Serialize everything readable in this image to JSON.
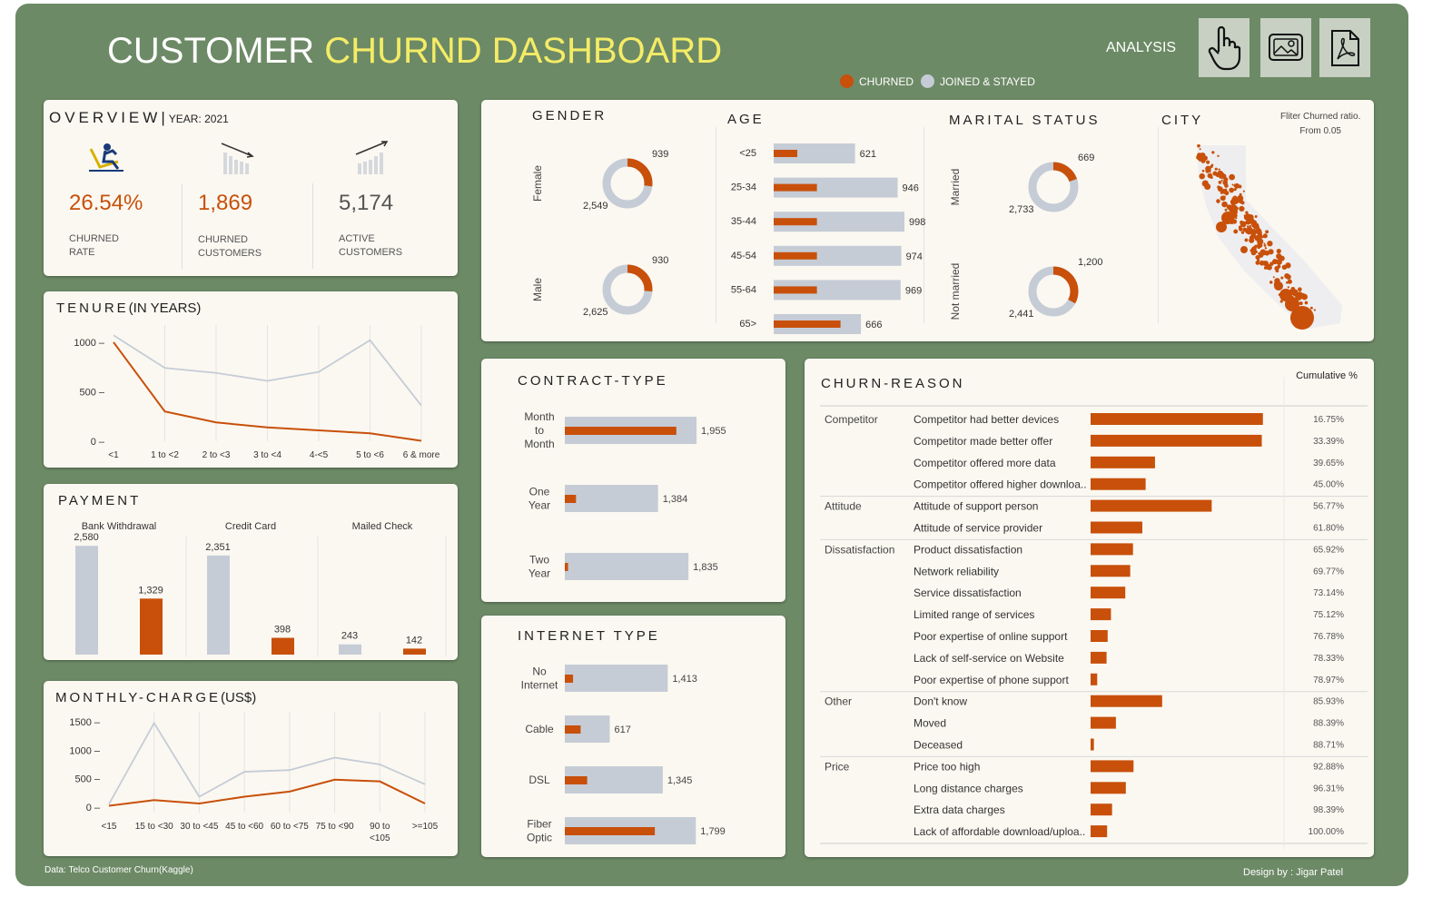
{
  "header": {
    "title_white": "CUSTOMER",
    "title_yellow": "CHURND DASHBOARD",
    "analysis_label": "ANALYSIS",
    "legend": [
      {
        "label": "CHURNED",
        "color": "#c8500a"
      },
      {
        "label": "JOINED & STAYED",
        "color": "#c5ccd6"
      }
    ],
    "icons": [
      "hand-pointer-icon",
      "image-icon",
      "pdf-icon"
    ]
  },
  "colors": {
    "churned": "#c8500a",
    "stayed": "#c5ccd6",
    "background": "#6d8a66",
    "card": "#fbf8f1",
    "title_yellow": "#f4ec66"
  },
  "overview": {
    "title": "OVERVIEW",
    "year_label": "YEAR: 2021",
    "kpis": [
      {
        "value": "26.54%",
        "label_1": "CHURNED",
        "label_2": "RATE",
        "icon": "person-falling-icon"
      },
      {
        "value": "1,869",
        "label_1": "CHURNED",
        "label_2": "CUSTOMERS",
        "icon": "bars-down-icon"
      },
      {
        "value": "5,174",
        "label_1": "ACTIVE",
        "label_2": "CUSTOMERS",
        "icon": "bars-up-icon"
      }
    ]
  },
  "tenure": {
    "title": "TENURE",
    "title_suffix": "(IN YEARS)"
  },
  "payment": {
    "title": "PAYMENT"
  },
  "monthly": {
    "title": "MONTHLY-CHARGE",
    "title_suffix": "(US$)"
  },
  "gender": {
    "title": "GENDER"
  },
  "age": {
    "title": "AGE"
  },
  "marital": {
    "title": "MARITAL STATUS"
  },
  "city": {
    "title": "CITY",
    "note_1": "Fliter Churned ratio.",
    "note_2": "From 0.05"
  },
  "contract": {
    "title": "CONTRACT-TYPE"
  },
  "internet": {
    "title": "INTERNET TYPE"
  },
  "reason": {
    "title": "CHURN-REASON",
    "cumulative_header": "Cumulative %"
  },
  "footer": {
    "source": "Data: Telco Customer Churn(Kaggle)",
    "credit": "Design by : Jigar Patel"
  },
  "chart_data": [
    {
      "id": "tenure",
      "type": "line",
      "categories": [
        "<1",
        "1 to <2",
        "2 to <3",
        "3 to <4",
        "4-<5",
        "5 to <6",
        "6 & more"
      ],
      "ylim": [
        0,
        1100
      ],
      "yticks": [
        0,
        500,
        1000
      ],
      "series": [
        {
          "name": "CHURNED",
          "values": [
            1000,
            300,
            190,
            140,
            110,
            80,
            5
          ]
        },
        {
          "name": "JOINED & STAYED",
          "values": [
            1070,
            740,
            690,
            610,
            700,
            1020,
            360
          ]
        }
      ]
    },
    {
      "id": "payment",
      "type": "bar",
      "groups": [
        {
          "label": "Bank Withdrawal",
          "stayed": 2580,
          "churned": 1329,
          "stayed_label": "2,580",
          "churned_label": "1,329"
        },
        {
          "label": "Credit Card",
          "stayed": 2351,
          "churned": 398,
          "stayed_label": "2,351",
          "churned_label": "398"
        },
        {
          "label": "Mailed Check",
          "stayed": 243,
          "churned": 142,
          "stayed_label": "243",
          "churned_label": "142"
        }
      ],
      "ylim": [
        0,
        2800
      ]
    },
    {
      "id": "monthly",
      "type": "line",
      "categories": [
        "<15",
        "15 to <30",
        "30 to <45",
        "45 to <60",
        "60 to <75",
        "75 to <90",
        "90 to <105",
        ">=105"
      ],
      "ylim": [
        -100,
        1550
      ],
      "yticks": [
        0,
        500,
        1000,
        1500
      ],
      "series": [
        {
          "name": "CHURNED",
          "values": [
            20,
            120,
            60,
            180,
            270,
            480,
            450,
            60
          ]
        },
        {
          "name": "JOINED & STAYED",
          "values": [
            50,
            1480,
            180,
            620,
            650,
            870,
            750,
            400
          ]
        }
      ]
    },
    {
      "id": "gender",
      "type": "pie",
      "items": [
        {
          "label": "Female",
          "churned": 939,
          "stayed": 2549,
          "churned_label": "939",
          "stayed_label": "2,549"
        },
        {
          "label": "Male",
          "churned": 930,
          "stayed": 2625,
          "churned_label": "930",
          "stayed_label": "2,625"
        }
      ]
    },
    {
      "id": "marital",
      "type": "pie",
      "items": [
        {
          "label": "Married",
          "churned": 669,
          "stayed": 2733,
          "churned_label": "669",
          "stayed_label": "2,733"
        },
        {
          "label": "Not married",
          "churned": 1200,
          "stayed": 2441,
          "churned_label": "1,200",
          "stayed_label": "2,441"
        }
      ]
    },
    {
      "id": "age",
      "type": "bar",
      "items": [
        {
          "label": "<25",
          "total": 621,
          "churned": 180,
          "total_label": "621"
        },
        {
          "label": "25-34",
          "total": 946,
          "churned": 330,
          "total_label": "946"
        },
        {
          "label": "35-44",
          "total": 998,
          "churned": 330,
          "total_label": "998"
        },
        {
          "label": "45-54",
          "total": 974,
          "churned": 330,
          "total_label": "974"
        },
        {
          "label": "55-64",
          "total": 969,
          "churned": 330,
          "total_label": "969"
        },
        {
          "label": "65>",
          "total": 666,
          "churned": 510,
          "total_label": "666"
        }
      ],
      "xlim": [
        0,
        1100
      ]
    },
    {
      "id": "contract",
      "type": "bar",
      "items": [
        {
          "label_1": "Month",
          "label_2": "to",
          "label_3": "Month",
          "total": 1955,
          "churned": 1655,
          "total_label": "1,955"
        },
        {
          "label_1": "One",
          "label_2": "Year",
          "label_3": "",
          "total": 1384,
          "churned": 166,
          "total_label": "1,384"
        },
        {
          "label_1": "Two",
          "label_2": "Year",
          "label_3": "",
          "total": 1835,
          "churned": 48,
          "total_label": "1,835"
        }
      ],
      "xlim": [
        0,
        2300
      ]
    },
    {
      "id": "internet",
      "type": "bar",
      "items": [
        {
          "label_1": "No",
          "label_2": "Internet",
          "total": 1413,
          "churned": 113,
          "total_label": "1,413"
        },
        {
          "label_1": "Cable",
          "label_2": "",
          "total": 617,
          "churned": 217,
          "total_label": "617"
        },
        {
          "label_1": "DSL",
          "label_2": "",
          "total": 1345,
          "churned": 307,
          "total_label": "1,345"
        },
        {
          "label_1": "Fiber",
          "label_2": "Optic",
          "total": 1799,
          "churned": 1236,
          "total_label": "1,799"
        }
      ],
      "xlim": [
        0,
        2300
      ]
    },
    {
      "id": "churn_reason",
      "type": "bar",
      "xlim": [
        0,
        320
      ],
      "groups": [
        {
          "category": "Competitor",
          "items": [
            {
              "reason": "Competitor had better devices",
              "count": 313,
              "cumulative": "16.75%"
            },
            {
              "reason": "Competitor made better offer",
              "count": 311,
              "cumulative": "33.39%"
            },
            {
              "reason": "Competitor offered more data",
              "count": 117,
              "cumulative": "39.65%"
            },
            {
              "reason": "Competitor offered higher downloa..",
              "count": 100,
              "cumulative": "45.00%"
            }
          ]
        },
        {
          "category": "Attitude",
          "items": [
            {
              "reason": "Attitude of support person",
              "count": 220,
              "cumulative": "56.77%"
            },
            {
              "reason": "Attitude of service provider",
              "count": 94,
              "cumulative": "61.80%"
            }
          ]
        },
        {
          "category": "Dissatisfaction",
          "items": [
            {
              "reason": "Product dissatisfaction",
              "count": 77,
              "cumulative": "65.92%"
            },
            {
              "reason": "Network reliability",
              "count": 72,
              "cumulative": "69.77%"
            },
            {
              "reason": "Service dissatisfaction",
              "count": 63,
              "cumulative": "73.14%"
            },
            {
              "reason": "Limited range of services",
              "count": 37,
              "cumulative": "75.12%"
            },
            {
              "reason": "Poor expertise of online support",
              "count": 31,
              "cumulative": "76.78%"
            },
            {
              "reason": "Lack of self-service on Website",
              "count": 29,
              "cumulative": "78.33%"
            },
            {
              "reason": "Poor expertise of phone support",
              "count": 12,
              "cumulative": "78.97%"
            }
          ]
        },
        {
          "category": "Other",
          "items": [
            {
              "reason": "Don't know",
              "count": 130,
              "cumulative": "85.93%"
            },
            {
              "reason": "Moved",
              "count": 46,
              "cumulative": "88.39%"
            },
            {
              "reason": "Deceased",
              "count": 6,
              "cumulative": "88.71%"
            }
          ]
        },
        {
          "category": "Price",
          "items": [
            {
              "reason": "Price too high",
              "count": 78,
              "cumulative": "92.88%"
            },
            {
              "reason": "Long distance charges",
              "count": 64,
              "cumulative": "96.31%"
            },
            {
              "reason": "Extra data charges",
              "count": 39,
              "cumulative": "98.39%"
            },
            {
              "reason": "Lack of affordable download/uploa..",
              "count": 30,
              "cumulative": "100.00%"
            }
          ]
        }
      ]
    },
    {
      "id": "city",
      "type": "scatter",
      "description_label": "CITY"
    }
  ]
}
